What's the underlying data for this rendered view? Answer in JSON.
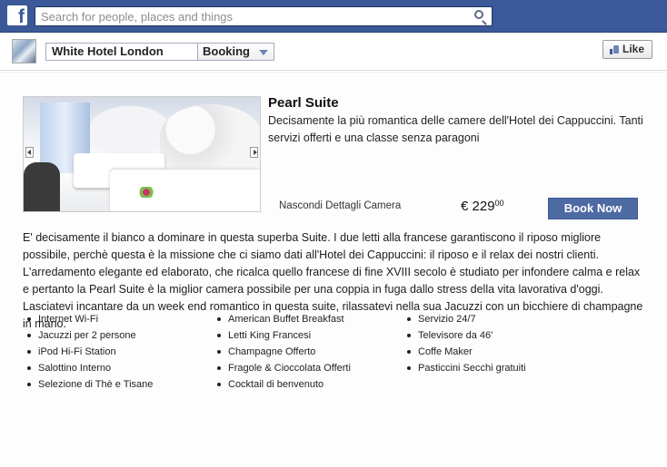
{
  "facebook": {
    "logo_letter": "f",
    "search_placeholder": "Search for people, places and things"
  },
  "app_header": {
    "page_name": "White Hotel London",
    "section": "Booking",
    "like_label": "Like"
  },
  "room": {
    "title": "Pearl Suite",
    "short_description": "Decisamente la più romantica delle camere dell'Hotel dei Cappuccini. Tanti servizi offerti e una classe senza paragoni",
    "hide_details_label": "Nascondi Dettagli Camera",
    "price_main": "€ 229",
    "price_cents": "00",
    "book_label": "Book Now",
    "long_description": "E' decisamente il bianco a dominare in questa superba Suite. I due letti alla francese garantiscono il riposo migliore possibile, perchè questa è la missione che ci siamo dati all'Hotel dei Cappuccini: il riposo e il relax dei nostri clienti. L'arredamento elegante ed elaborato, che ricalca quello francese di fine XVIII secolo è studiato per infondere calma e relax e pertanto la Pearl Suite è la miglior camera possibile per una coppia in fuga dallo stress della vita lavorativa d'oggi. Lasciatevi incantare da un week end romantico in questa suite, rilassatevi nella sua Jacuzzi con un bicchiere di champagne in mano.",
    "amenities_col1": [
      "Internet Wi-Fi",
      "Jacuzzi per 2 persone",
      "iPod Hi-Fi Station",
      "Salottino Interno",
      "Selezione di Thè e Tisane"
    ],
    "amenities_col2": [
      "American Buffet Breakfast",
      "Letti King Francesi",
      "Champagne Offerto",
      "Fragole & Cioccolata Offerti",
      "Cocktail di benvenuto"
    ],
    "amenities_col3": [
      "Servizio 24/7",
      "Televisore da 46'",
      "Coffe Maker",
      "Pasticcini Secchi gratuiti"
    ]
  }
}
